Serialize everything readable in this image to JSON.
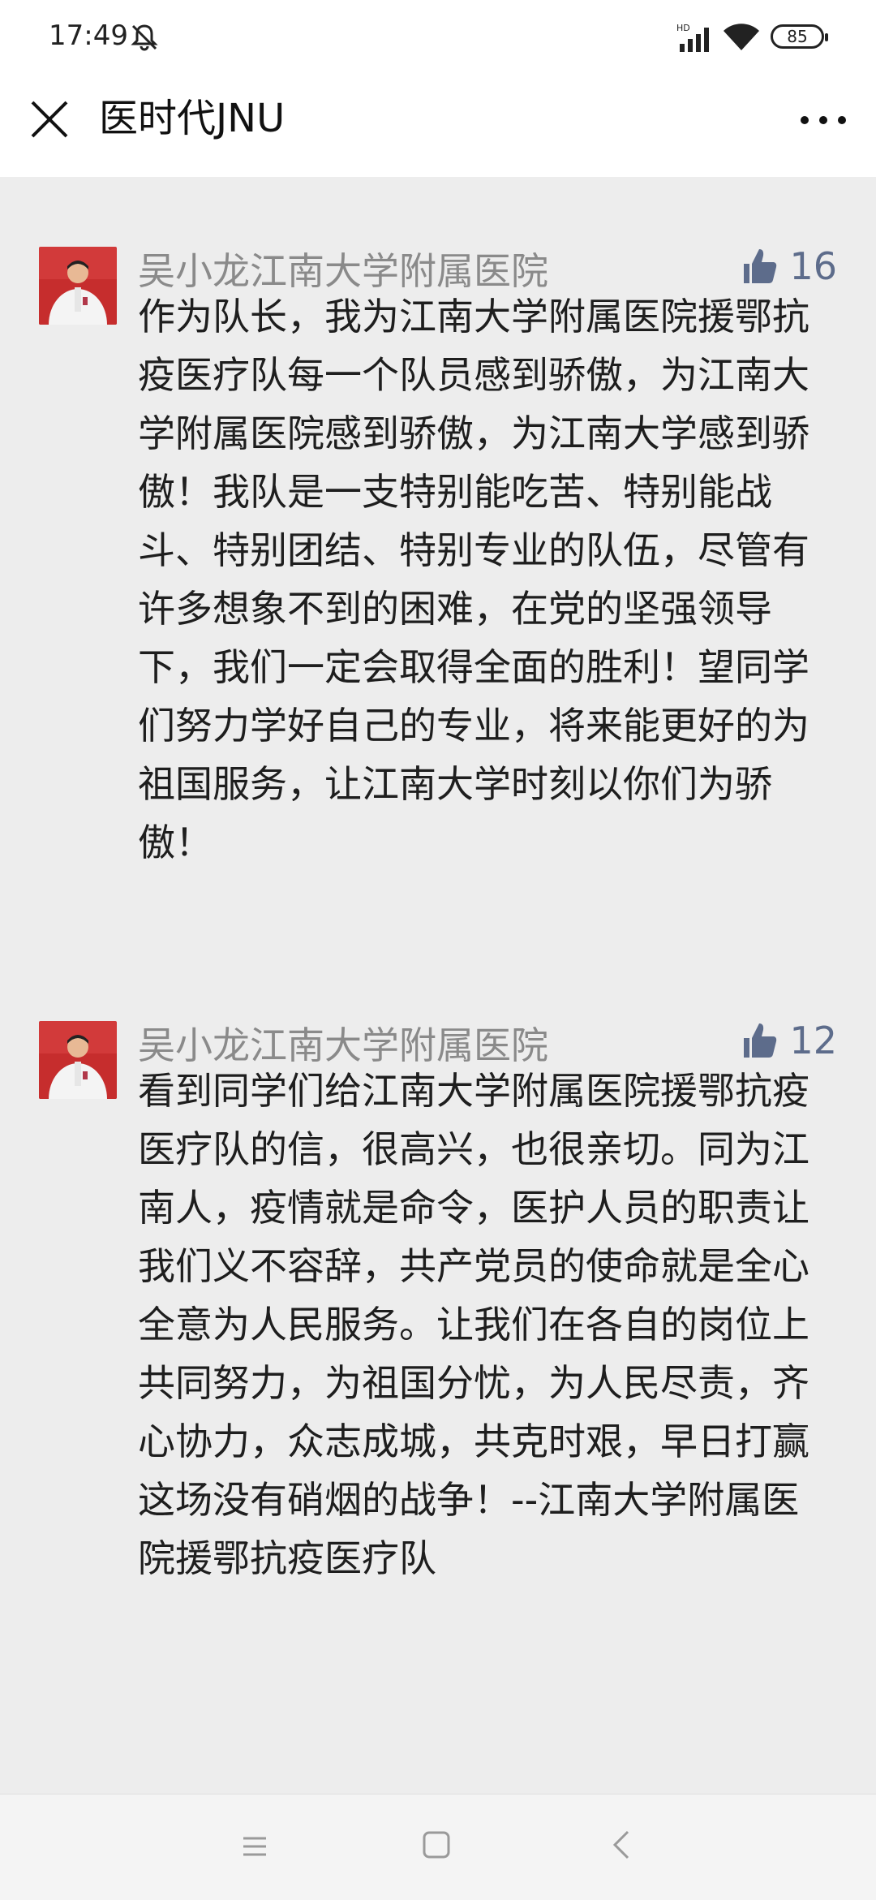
{
  "status_bar": {
    "time": "17:49",
    "battery": "85",
    "icons": [
      "mute-icon",
      "hd-signal-icon",
      "wifi-icon",
      "battery-icon"
    ]
  },
  "nav": {
    "title": "医时代JNU",
    "close_icon": "close-icon",
    "more_icon": "more-icon"
  },
  "comments": [
    {
      "author": "吴小龙江南大学附属医院",
      "likes": "16",
      "text": "作为队长，我为江南大学附属医院援鄂抗疫医疗队每一个队员感到骄傲，为江南大学附属医院感到骄傲，为江南大学感到骄傲！我队是一支特别能吃苦、特别能战斗、特别团结、特别专业的队伍，尽管有许多想象不到的困难，在党的坚强领导下，我们一定会取得全面的胜利！望同学们努力学好自己的专业，将来能更好的为祖国服务，让江南大学时刻以你们为骄傲！"
    },
    {
      "author": "吴小龙江南大学附属医院",
      "likes": "12",
      "text": "看到同学们给江南大学附属医院援鄂抗疫医疗队的信，很高兴，也很亲切。同为江南人，疫情就是命令，医护人员的职责让我们义不容辞，共产党员的使命就是全心全意为人民服务。让我们在各自的岗位上共同努力，为祖国分忧，为人民尽责，齐心协力，众志成城，共克时艰，早日打赢这场没有硝烟的战争！--江南大学附属医院援鄂抗疫医疗队"
    }
  ],
  "bottom_nav": {
    "icons": [
      "menu-icon",
      "home-icon",
      "back-icon"
    ]
  },
  "colors": {
    "background": "#ededed",
    "author": "#8a8a8a",
    "like": "#5d6c8b",
    "text": "#1e1e1e"
  }
}
